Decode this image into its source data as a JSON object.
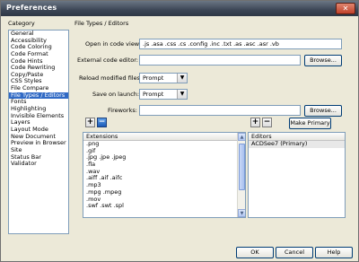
{
  "window": {
    "title": "Preferences",
    "close_glyph": "✕"
  },
  "sidebar": {
    "label": "Category",
    "items": [
      "General",
      "Accessibility",
      "Code Coloring",
      "Code Format",
      "Code Hints",
      "Code Rewriting",
      "Copy/Paste",
      "CSS Styles",
      "File Compare",
      "File Types / Editors",
      "Fonts",
      "Highlighting",
      "Invisible Elements",
      "Layers",
      "Layout Mode",
      "New Document",
      "Preview in Browser",
      "Site",
      "Status Bar",
      "Validator"
    ],
    "selected_index": 9
  },
  "panel": {
    "title": "File Types / Editors",
    "open_in_code_view": {
      "label": "Open in code view:",
      "value": ".js .asa .css .cs .config .inc .txt .as .asc .asr .vb"
    },
    "external_code_editor": {
      "label": "External code editor:",
      "value": "",
      "browse": "Browse..."
    },
    "reload_modified_files": {
      "label": "Reload modified files:",
      "value": "Prompt"
    },
    "save_on_launch": {
      "label": "Save on launch:",
      "value": "Prompt"
    },
    "fireworks": {
      "label": "Fireworks:",
      "value": "",
      "browse": "Browse..."
    },
    "make_primary": "Make Primary",
    "plus": "+",
    "minus": "−",
    "extensions": {
      "header": "Extensions",
      "items": [
        ".png",
        ".gif",
        ".jpg .jpe .jpeg",
        ".fla",
        ".wav",
        ".aiff .aif .aifc",
        ".mp3",
        ".mpg .mpeg",
        ".mov",
        ".swf .swt .spl"
      ]
    },
    "editors": {
      "header": "Editors",
      "items": [
        "ACDSee7 (Primary)"
      ]
    }
  },
  "footer": {
    "ok": "OK",
    "cancel": "Cancel",
    "help": "Help"
  }
}
